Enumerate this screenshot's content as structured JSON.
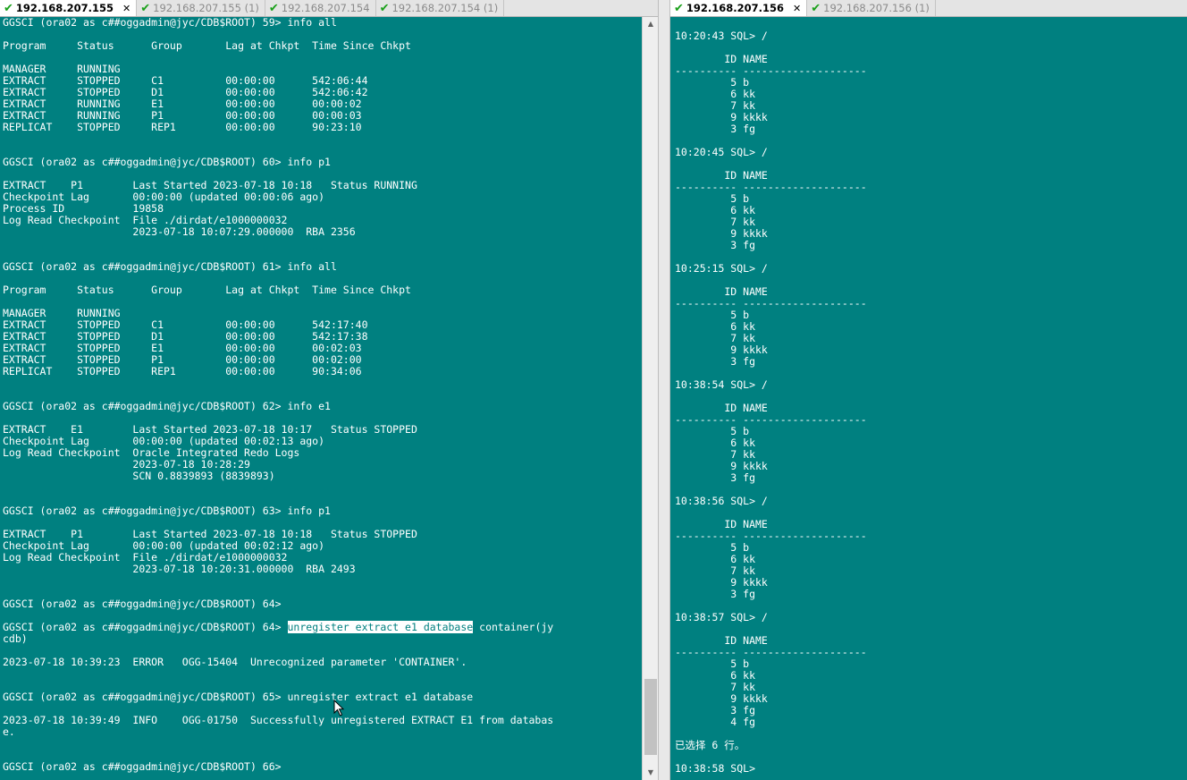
{
  "tabs_left": [
    {
      "label": "192.168.207.155",
      "active": true
    },
    {
      "label": "192.168.207.155 (1)",
      "active": false
    },
    {
      "label": "192.168.207.154",
      "active": false
    },
    {
      "label": "192.168.207.154 (1)",
      "active": false
    }
  ],
  "tabs_right": [
    {
      "label": "192.168.207.156",
      "active": true
    },
    {
      "label": "192.168.207.156 (1)",
      "active": false
    }
  ],
  "colors": {
    "terminal_bg": "#008080",
    "terminal_fg": "#ffffff",
    "tab_check": "#1aa01a"
  },
  "left_terminal": {
    "before_sel": "GGSCI (ora02 as c##oggadmin@jyc/CDB$ROOT) 59> info all\n\nProgram     Status      Group       Lag at Chkpt  Time Since Chkpt\n\nMANAGER     RUNNING\nEXTRACT     STOPPED     C1          00:00:00      542:06:44\nEXTRACT     STOPPED     D1          00:00:00      542:06:42\nEXTRACT     RUNNING     E1          00:00:00      00:00:02\nEXTRACT     RUNNING     P1          00:00:00      00:00:03\nREPLICAT    STOPPED     REP1        00:00:00      90:23:10\n\n\nGGSCI (ora02 as c##oggadmin@jyc/CDB$ROOT) 60> info p1\n\nEXTRACT    P1        Last Started 2023-07-18 10:18   Status RUNNING\nCheckpoint Lag       00:00:00 (updated 00:00:06 ago)\nProcess ID           19858\nLog Read Checkpoint  File ./dirdat/e1000000032\n                     2023-07-18 10:07:29.000000  RBA 2356\n\n\nGGSCI (ora02 as c##oggadmin@jyc/CDB$ROOT) 61> info all\n\nProgram     Status      Group       Lag at Chkpt  Time Since Chkpt\n\nMANAGER     RUNNING\nEXTRACT     STOPPED     C1          00:00:00      542:17:40\nEXTRACT     STOPPED     D1          00:00:00      542:17:38\nEXTRACT     STOPPED     E1          00:00:00      00:02:03\nEXTRACT     STOPPED     P1          00:00:00      00:02:00\nREPLICAT    STOPPED     REP1        00:00:00      90:34:06\n\n\nGGSCI (ora02 as c##oggadmin@jyc/CDB$ROOT) 62> info e1\n\nEXTRACT    E1        Last Started 2023-07-18 10:17   Status STOPPED\nCheckpoint Lag       00:00:00 (updated 00:02:13 ago)\nLog Read Checkpoint  Oracle Integrated Redo Logs\n                     2023-07-18 10:28:29\n                     SCN 0.8839893 (8839893)\n\n\nGGSCI (ora02 as c##oggadmin@jyc/CDB$ROOT) 63> info p1\n\nEXTRACT    P1        Last Started 2023-07-18 10:18   Status STOPPED\nCheckpoint Lag       00:00:00 (updated 00:02:12 ago)\nLog Read Checkpoint  File ./dirdat/e1000000032\n                     2023-07-18 10:20:31.000000  RBA 2493\n\n\nGGSCI (ora02 as c##oggadmin@jyc/CDB$ROOT) 64>\n\nGGSCI (ora02 as c##oggadmin@jyc/CDB$ROOT) 64> ",
    "selected": "unregister extract e1 database",
    "after_sel": " container(jy\ncdb)\n\n2023-07-18 10:39:23  ERROR   OGG-15404  Unrecognized parameter 'CONTAINER'.\n\n\nGGSCI (ora02 as c##oggadmin@jyc/CDB$ROOT) 65> unregister extract e1 database\n\n2023-07-18 10:39:49  INFO    OGG-01750  Successfully unregistered EXTRACT E1 from databas\ne.\n\n\nGGSCI (ora02 as c##oggadmin@jyc/CDB$ROOT) 66> "
  },
  "right_terminal": {
    "text": "10:20:43 SQL> /\n\n        ID NAME\n---------- --------------------\n         5 b\n         6 kk\n         7 kk\n         9 kkkk\n         3 fg\n\n10:20:45 SQL> /\n\n        ID NAME\n---------- --------------------\n         5 b\n         6 kk\n         7 kk\n         9 kkkk\n         3 fg\n\n10:25:15 SQL> /\n\n        ID NAME\n---------- --------------------\n         5 b\n         6 kk\n         7 kk\n         9 kkkk\n         3 fg\n\n10:38:54 SQL> /\n\n        ID NAME\n---------- --------------------\n         5 b\n         6 kk\n         7 kk\n         9 kkkk\n         3 fg\n\n10:38:56 SQL> /\n\n        ID NAME\n---------- --------------------\n         5 b\n         6 kk\n         7 kk\n         9 kkkk\n         3 fg\n\n10:38:57 SQL> /\n\n        ID NAME\n---------- --------------------\n         5 b\n         6 kk\n         7 kk\n         9 kkkk\n         3 fg\n         4 fg\n\n已选择 6 行。\n\n10:38:58 SQL> "
  }
}
